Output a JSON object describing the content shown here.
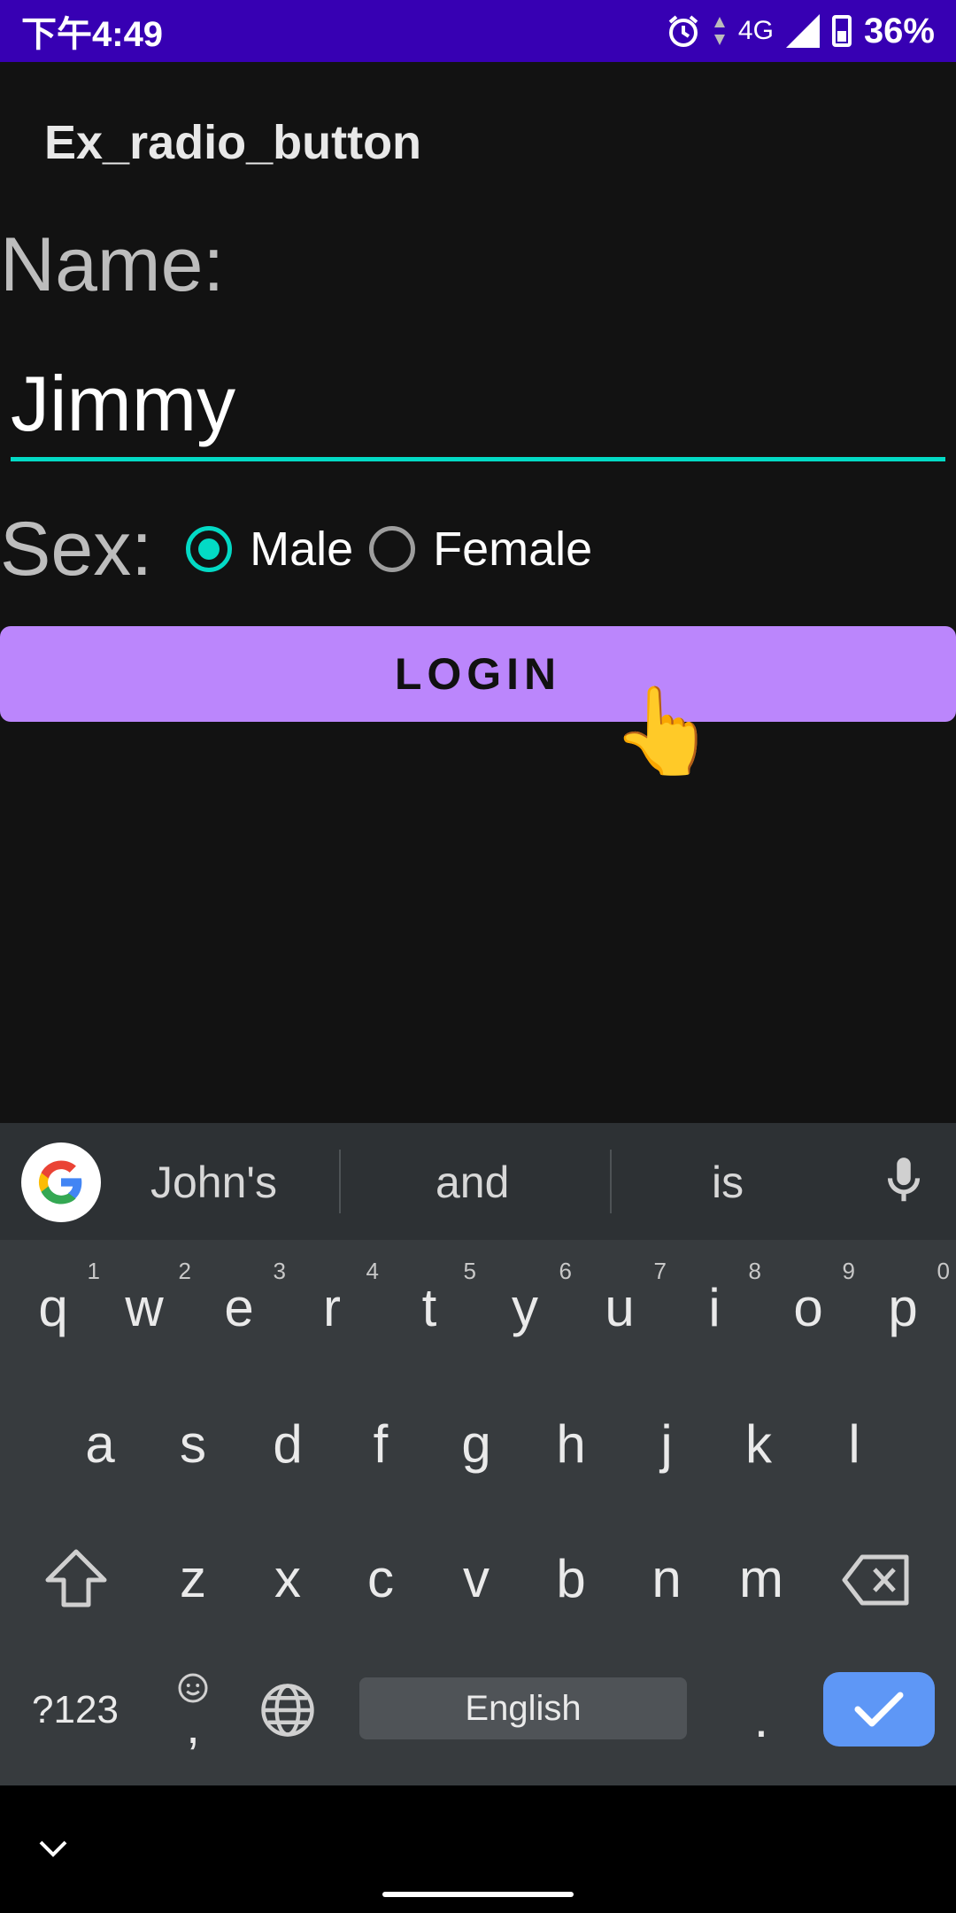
{
  "status_bar": {
    "time": "下午4:49",
    "network": "4G",
    "battery": "36%"
  },
  "app_bar": {
    "title": "Ex_radio_button"
  },
  "form": {
    "name_label": "Name:",
    "name_value": "Jimmy",
    "sex_label": "Sex:",
    "options": [
      {
        "label": "Male",
        "checked": true
      },
      {
        "label": "Female",
        "checked": false
      }
    ],
    "login_label": "LOGIN"
  },
  "keyboard": {
    "suggestions": [
      "John's",
      "and",
      "is"
    ],
    "row1": [
      {
        "key": "q",
        "hint": "1"
      },
      {
        "key": "w",
        "hint": "2"
      },
      {
        "key": "e",
        "hint": "3"
      },
      {
        "key": "r",
        "hint": "4"
      },
      {
        "key": "t",
        "hint": "5"
      },
      {
        "key": "y",
        "hint": "6"
      },
      {
        "key": "u",
        "hint": "7"
      },
      {
        "key": "i",
        "hint": "8"
      },
      {
        "key": "o",
        "hint": "9"
      },
      {
        "key": "p",
        "hint": "0"
      }
    ],
    "row2": [
      "a",
      "s",
      "d",
      "f",
      "g",
      "h",
      "j",
      "k",
      "l"
    ],
    "row3": [
      "z",
      "x",
      "c",
      "v",
      "b",
      "n",
      "m"
    ],
    "symbols_label": "?123",
    "comma_label": ",",
    "space_label": "English",
    "period_label": "."
  },
  "colors": {
    "status_bar": "#3700b3",
    "accent": "#03dac5",
    "button": "#bb86fc",
    "enter_key": "#5e97f6"
  }
}
